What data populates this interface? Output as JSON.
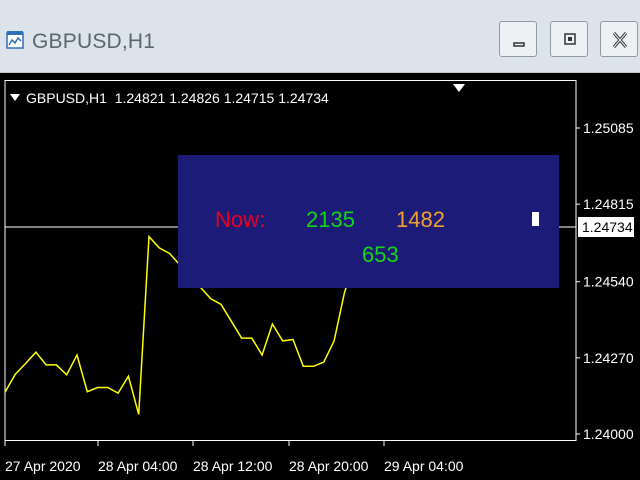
{
  "window": {
    "title": "GBPUSD,H1",
    "buttons": {
      "minimize": "minimize",
      "restore": "restore",
      "close": "close"
    }
  },
  "chart_header": {
    "symbol": "GBPUSD,H1",
    "ohlc": "1.24821 1.24826 1.24715 1.24734"
  },
  "panel": {
    "now_label": "Now:",
    "value_green": "2135",
    "value_orange": "1482",
    "value_green2": "653",
    "colors": {
      "label": "#e8001e",
      "green": "#12d712",
      "orange": "#f0a030",
      "background": "#1c1c78"
    }
  },
  "current_price": "1.24734",
  "colors": {
    "line": "#ffff00",
    "axis": "#ffffff",
    "background": "#000000"
  },
  "chart_data": {
    "type": "line",
    "ylabel": "",
    "xlabel": "",
    "y_ticks": [
      "1.25085",
      "1.24815",
      "1.24540",
      "1.24270",
      "1.24000"
    ],
    "y_tick_values": [
      1.25085,
      1.24815,
      1.2454,
      1.2427,
      1.24
    ],
    "x_ticks": [
      "27 Apr 2020",
      "28 Apr 04:00",
      "28 Apr 12:00",
      "28 Apr 20:00",
      "29 Apr 04:00"
    ],
    "ylim": [
      1.24,
      1.25085
    ],
    "series": [
      {
        "values": [
          1.24148,
          1.24212,
          1.2425,
          1.2429,
          1.24245,
          1.24245,
          1.2421,
          1.2428,
          1.2415,
          1.24165,
          1.24165,
          1.24145,
          1.24205,
          1.2407,
          1.247,
          1.2466,
          1.2464,
          1.246,
          1.2457,
          1.2452,
          1.2448,
          1.2446,
          1.244,
          1.2434,
          1.2434,
          1.2428,
          1.2439,
          1.2433,
          1.24335,
          1.2424,
          1.2424,
          1.24255,
          1.2433,
          1.245,
          1.2462
        ]
      }
    ],
    "current_value": 1.24734
  }
}
